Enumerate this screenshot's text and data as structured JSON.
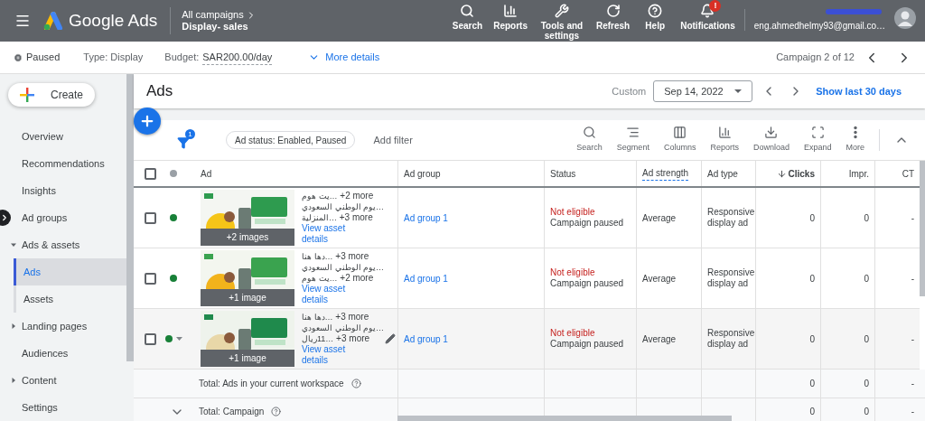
{
  "topbar": {
    "brand": "Google Ads",
    "breadcrumb": {
      "parent": "All campaigns",
      "current": "Display- sales"
    },
    "nav": [
      {
        "label": "Search"
      },
      {
        "label": "Reports"
      },
      {
        "label": "Tools and settings"
      },
      {
        "label": "Refresh"
      },
      {
        "label": "Help"
      },
      {
        "label": "Notifications",
        "badge": "!"
      }
    ],
    "account": "eng.ahmedhelmy93@gmail.co…"
  },
  "campaign_bar": {
    "status": "Paused",
    "type": "Type: Display",
    "budget_label": "Budget:",
    "budget": "SAR200.00/day",
    "more": "More details",
    "pager": "Campaign 2 of 12"
  },
  "create": "Create",
  "sidebar": {
    "items": [
      {
        "label": "Overview",
        "selected": false
      },
      {
        "label": "Recommendations",
        "selected": false
      },
      {
        "label": "Insights",
        "selected": false
      },
      {
        "label": "Ad groups",
        "selected": false
      },
      {
        "label": "Ads & assets",
        "selected": false,
        "expanded": true,
        "children": [
          {
            "label": "Ads",
            "selected": true
          },
          {
            "label": "Assets",
            "selected": false
          }
        ]
      },
      {
        "label": "Landing pages",
        "selected": false,
        "expanded": false
      },
      {
        "label": "Audiences",
        "selected": false
      },
      {
        "label": "Content",
        "selected": false,
        "expanded": false
      },
      {
        "label": "Settings",
        "selected": false
      }
    ]
  },
  "header": {
    "title": "Ads",
    "date_label": "Custom",
    "date": "Sep 14, 2022",
    "show_last": "Show last 30 days"
  },
  "toolbar": {
    "filter_count": "1",
    "chip": "Ad status: Enabled, Paused",
    "add_filter": "Add filter",
    "tools": [
      {
        "label": "Search"
      },
      {
        "label": "Segment"
      },
      {
        "label": "Columns"
      },
      {
        "label": "Reports"
      },
      {
        "label": "Download"
      },
      {
        "label": "Expand"
      },
      {
        "label": "More"
      }
    ]
  },
  "table": {
    "select_all": {
      "checked": false
    },
    "columns": [
      {
        "label": "Ad",
        "kind": "text",
        "sorted": false,
        "hint": false
      },
      {
        "label": "Ad group",
        "kind": "text",
        "sorted": false,
        "hint": false
      },
      {
        "label": "Status",
        "kind": "text",
        "sorted": false,
        "hint": false
      },
      {
        "label": "Ad strength",
        "kind": "text",
        "sorted": false,
        "hint": true
      },
      {
        "label": "Ad type",
        "kind": "text",
        "sorted": false,
        "hint": false
      },
      {
        "label": "Clicks",
        "kind": "number",
        "sorted": true,
        "hint": false
      },
      {
        "label": "Impr.",
        "kind": "number",
        "sorted": false,
        "hint": false
      },
      {
        "label": "CT",
        "kind": "number",
        "sorted": false,
        "hint": false
      }
    ],
    "rows": [
      {
        "checked": false,
        "hovered": false,
        "color": "#188038",
        "images": "+2 images",
        "headlines": [
          {
            "text": "…يت هوم",
            "more": "+2 more"
          },
          {
            "text": "…يوم الوطني السعودي"
          },
          {
            "text": "…المنزلية",
            "more": "+3 more"
          }
        ],
        "link": "View asset details",
        "ad_group": "Ad group 1",
        "status": "Not eligible",
        "reason": "Campaign paused",
        "strength": "Average",
        "type": "Responsive display ad",
        "clicks": "0",
        "impr": "0",
        "ctr": "-"
      },
      {
        "checked": false,
        "hovered": false,
        "color": "#188038",
        "images": "+1 image",
        "headlines": [
          {
            "text": "…دها هنا",
            "more": "+3 more"
          },
          {
            "text": "…يوم الوطني السعودي"
          },
          {
            "text": "…يت هوم",
            "more": "+2 more"
          }
        ],
        "link": "View asset details",
        "ad_group": "Ad group 1",
        "status": "Not eligible",
        "reason": "Campaign paused",
        "strength": "Average",
        "type": "Responsive display ad",
        "clicks": "0",
        "impr": "0",
        "ctr": "-"
      },
      {
        "checked": false,
        "hovered": true,
        "color": "#188038",
        "images": "+1 image",
        "headlines": [
          {
            "text": "…دها هنا",
            "more": "+3 more"
          },
          {
            "text": "…يوم الوطني السعودي"
          },
          {
            "text": "…11ريال",
            "more": "+3 more"
          }
        ],
        "link": "View asset details",
        "ad_group": "Ad group 1",
        "status": "Not eligible",
        "reason": "Campaign paused",
        "strength": "Average",
        "type": "Responsive display ad",
        "clicks": "0",
        "impr": "0",
        "ctr": "-"
      }
    ],
    "totals": [
      {
        "kind": "workspace",
        "label": "Total: Ads in your current workspace",
        "clicks": "0",
        "impr": "0",
        "ctr": "-"
      },
      {
        "kind": "campaign",
        "label": "Total: Campaign",
        "clicks": "0",
        "impr": "0",
        "ctr": "-"
      }
    ]
  }
}
